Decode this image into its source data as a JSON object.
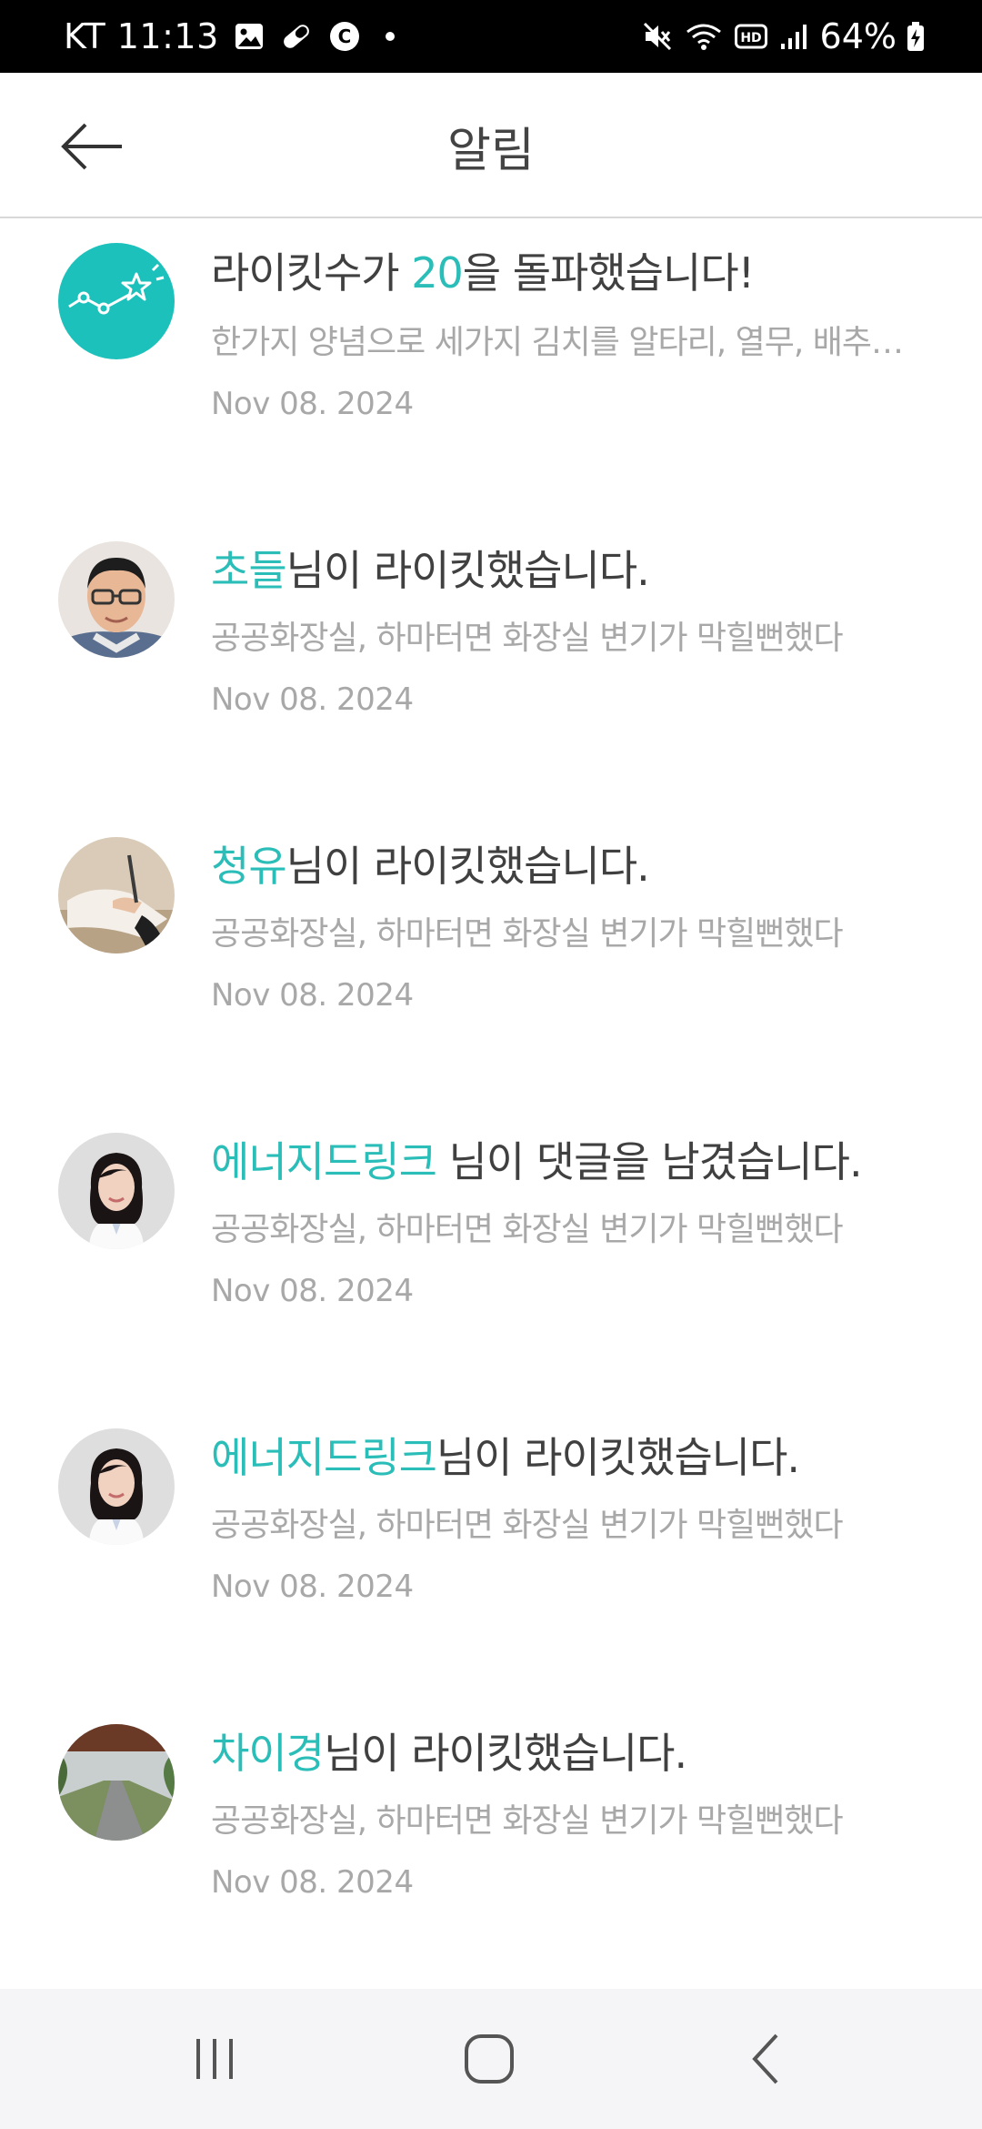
{
  "status_bar": {
    "carrier_time": "KT 11:13",
    "battery_percent": "64%",
    "icons": [
      "image-icon",
      "pill-icon",
      "c-badge-icon",
      "dot-icon",
      "mute-icon",
      "wifi-icon",
      "hd-icon",
      "signal-icon",
      "battery-charging-icon"
    ]
  },
  "header": {
    "title": "알림",
    "back_icon": "arrow-left-icon"
  },
  "colors": {
    "accent": "#2bbdb8",
    "title_text": "#404040",
    "muted_text": "#a8a8a8"
  },
  "notifications": [
    {
      "avatar": "trend-star-icon",
      "title_prefix": "라이킷수가 ",
      "title_accent": "20",
      "title_suffix": "을 돌파했습니다!",
      "preview": "한가지 양념으로 세가지 김치를 알타리, 열무, 배추 담그기",
      "date": "Nov 08. 2024"
    },
    {
      "avatar": "user-photo-man-glasses",
      "title_prefix": "",
      "title_accent": "초들",
      "title_suffix": "님이 라이킷했습니다.",
      "preview": "공공화장실, 하마터면 화장실 변기가 막힐뻔했다",
      "date": "Nov 08. 2024"
    },
    {
      "avatar": "user-photo-writing-hand",
      "title_prefix": "",
      "title_accent": "청유",
      "title_suffix": "님이 라이킷했습니다.",
      "preview": "공공화장실, 하마터면 화장실 변기가 막힐뻔했다",
      "date": "Nov 08. 2024"
    },
    {
      "avatar": "user-photo-woman-doctor",
      "title_prefix": "",
      "title_accent": "에너지드링크",
      "title_suffix": " 님이 댓글을 남겼습니다.",
      "preview": "공공화장실, 하마터면 화장실 변기가 막힐뻔했다",
      "date": "Nov 08. 2024"
    },
    {
      "avatar": "user-photo-woman-doctor",
      "title_prefix": "",
      "title_accent": "에너지드링크",
      "title_suffix": "님이 라이킷했습니다.",
      "preview": "공공화장실, 하마터면 화장실 변기가 막힐뻔했다",
      "date": "Nov 08. 2024"
    },
    {
      "avatar": "user-photo-country-road",
      "title_prefix": "",
      "title_accent": "차이경",
      "title_suffix": "님이 라이킷했습니다.",
      "preview": "공공화장실, 하마터면 화장실 변기가 막힐뻔했다",
      "date": "Nov 08. 2024"
    }
  ],
  "nav_bar": {
    "icons": [
      "recent-apps-icon",
      "home-icon",
      "back-icon"
    ]
  }
}
